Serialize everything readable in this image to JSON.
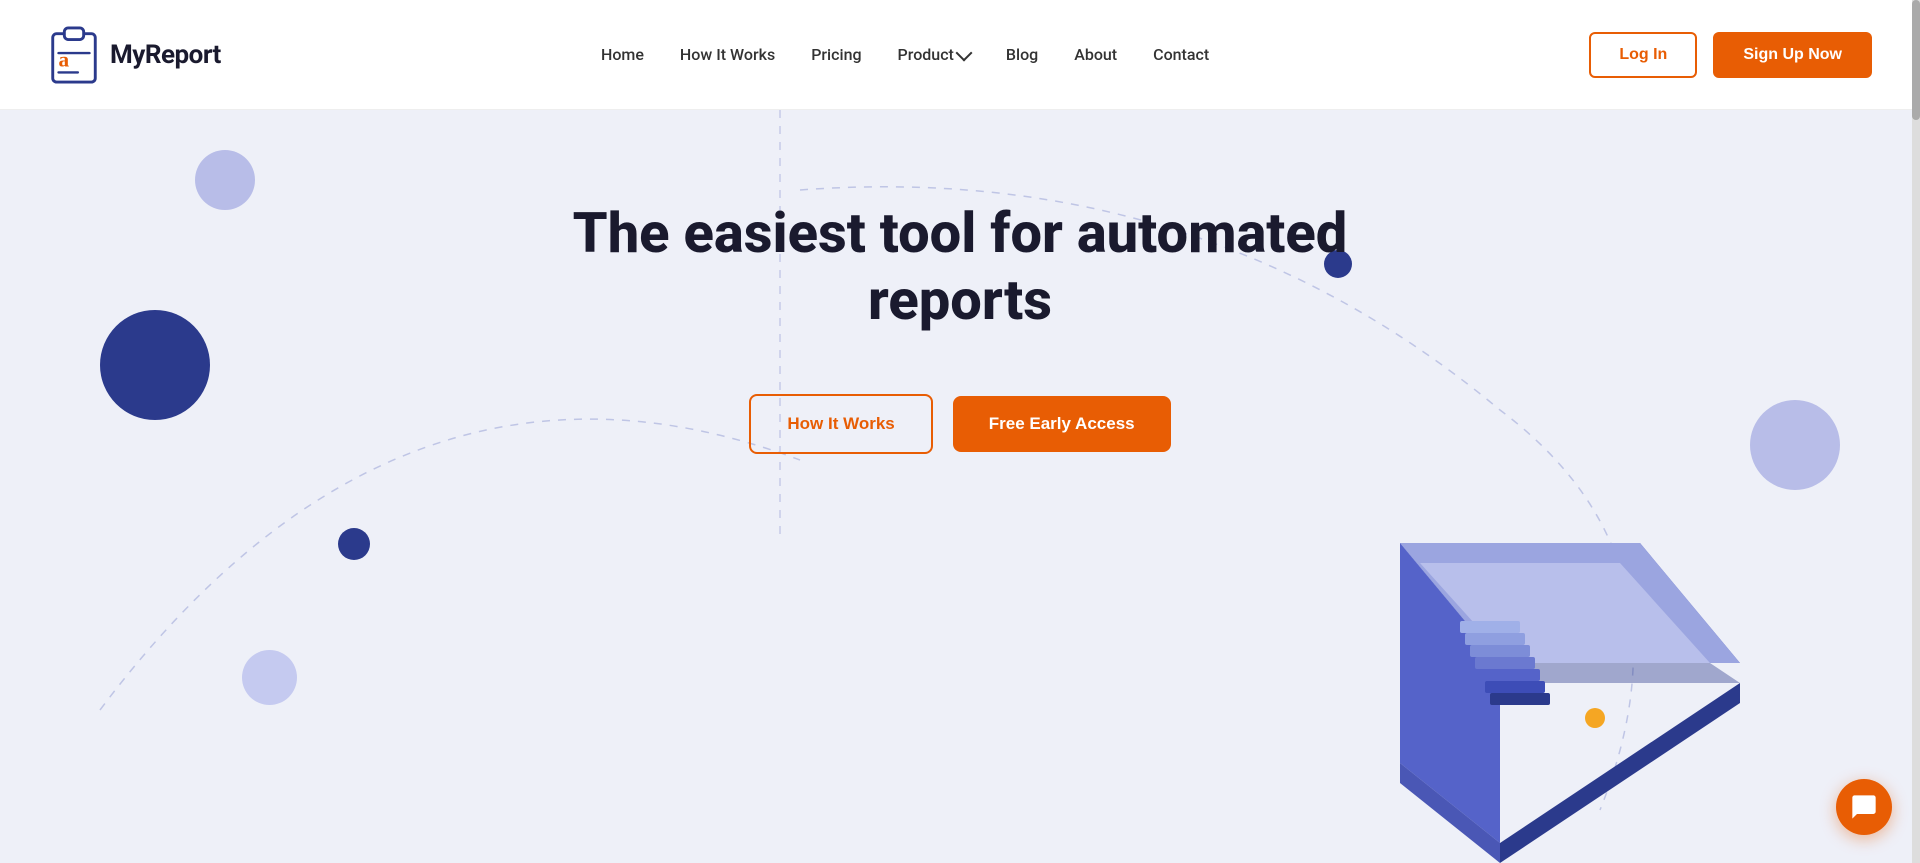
{
  "logo": {
    "text": "MyReport",
    "alt": "MyReport logo"
  },
  "nav": {
    "links": [
      {
        "id": "home",
        "label": "Home",
        "href": "#"
      },
      {
        "id": "how-it-works",
        "label": "How It Works",
        "href": "#"
      },
      {
        "id": "pricing",
        "label": "Pricing",
        "href": "#"
      },
      {
        "id": "product",
        "label": "Product",
        "href": "#",
        "hasDropdown": true
      },
      {
        "id": "blog",
        "label": "Blog",
        "href": "#"
      },
      {
        "id": "about",
        "label": "About",
        "href": "#"
      },
      {
        "id": "contact",
        "label": "Contact",
        "href": "#"
      }
    ],
    "login_label": "Log In",
    "signup_label": "Sign Up Now"
  },
  "hero": {
    "title_line1": "The easiest tool for automated",
    "title_line2": "reports",
    "btn_how_works": "How It Works",
    "btn_free_access": "Free Early Access"
  },
  "chat": {
    "icon_label": "chat-icon"
  }
}
